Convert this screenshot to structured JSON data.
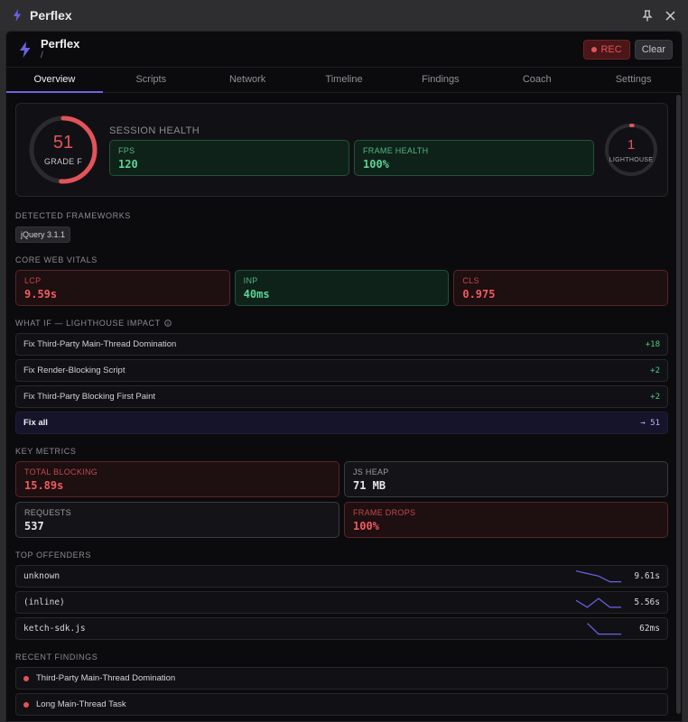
{
  "window": {
    "title": "Perflex",
    "pin_icon": "pin-icon",
    "close_icon": "close-icon"
  },
  "header": {
    "name": "Perflex",
    "path": "/",
    "rec_label": "REC",
    "clear_label": "Clear"
  },
  "tabs": [
    {
      "label": "Overview",
      "active": true
    },
    {
      "label": "Scripts"
    },
    {
      "label": "Network"
    },
    {
      "label": "Timeline"
    },
    {
      "label": "Findings"
    },
    {
      "label": "Coach"
    },
    {
      "label": "Settings"
    }
  ],
  "health": {
    "score": "51",
    "score_fraction": 0.51,
    "grade": "GRADE F",
    "title": "SESSION HEALTH",
    "fps_label": "FPS",
    "fps_value": "120",
    "frame_label": "FRAME HEALTH",
    "frame_value": "100%",
    "lighthouse_score": "1",
    "lighthouse_fraction": 0.01,
    "lighthouse_label": "LIGHTHOUSE"
  },
  "frameworks": {
    "title": "DETECTED FRAMEWORKS",
    "items": [
      "jQuery 3.1.1"
    ]
  },
  "vitals": {
    "title": "CORE WEB VITALS",
    "items": [
      {
        "label": "LCP",
        "value": "9.59s",
        "status": "bad"
      },
      {
        "label": "INP",
        "value": "40ms",
        "status": "good"
      },
      {
        "label": "CLS",
        "value": "0.975",
        "status": "bad"
      }
    ]
  },
  "whatif": {
    "title": "WHAT IF — LIGHTHOUSE IMPACT",
    "info_icon": "info-icon",
    "items": [
      {
        "label": "Fix Third-Party Main-Thread Domination",
        "delta": "+18"
      },
      {
        "label": "Fix Render-Blocking Script",
        "delta": "+2"
      },
      {
        "label": "Fix Third-Party Blocking First Paint",
        "delta": "+2"
      }
    ],
    "fix_all_label": "Fix all",
    "fix_all_value": "→ 51"
  },
  "key_metrics": {
    "title": "KEY METRICS",
    "items": [
      {
        "label": "TOTAL BLOCKING",
        "value": "15.89s",
        "status": "bad"
      },
      {
        "label": "JS HEAP",
        "value": "71 MB",
        "status": "neutral"
      },
      {
        "label": "REQUESTS",
        "value": "537",
        "status": "neutral"
      },
      {
        "label": "FRAME DROPS",
        "value": "100%",
        "status": "bad"
      }
    ]
  },
  "offenders": {
    "title": "TOP OFFENDERS",
    "sparkline_color": "#6a63e6",
    "items": [
      {
        "name": "unknown",
        "time": "9.61s",
        "spark": [
          0.95,
          0.75,
          0.55,
          0.1,
          0.1
        ]
      },
      {
        "name": "(inline)",
        "time": "5.56s",
        "spark": [
          0.7,
          0.15,
          0.85,
          0.15,
          0.15
        ]
      },
      {
        "name": "ketch-sdk.js",
        "time": "62ms",
        "spark": [
          null,
          0.95,
          0.1,
          0.1,
          0.1
        ]
      }
    ]
  },
  "findings": {
    "title": "RECENT FINDINGS",
    "items": [
      {
        "label": "Third-Party Main-Thread Domination"
      },
      {
        "label": "Long Main-Thread Task"
      }
    ]
  },
  "colors": {
    "accent": "#6a63e6",
    "bad": "#e45358",
    "good": "#5fd294"
  }
}
